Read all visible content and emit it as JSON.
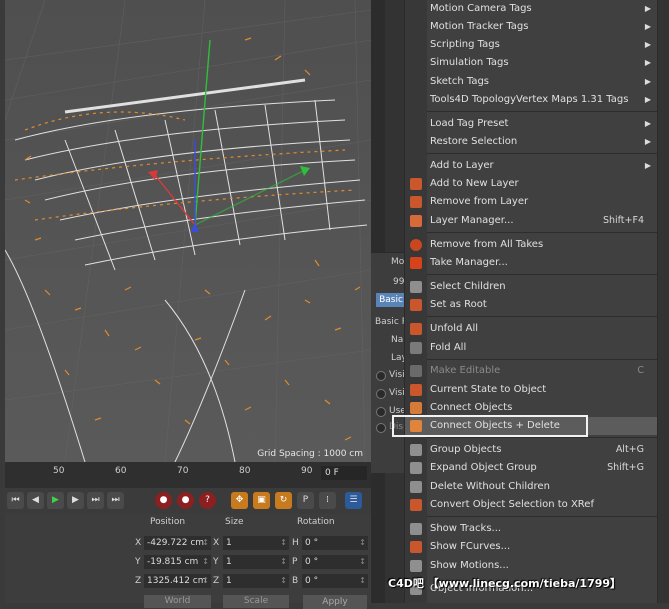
{
  "viewport": {
    "grid_spacing": "Grid Spacing : 1000 cm"
  },
  "attributes": {
    "title_fragment": "Mo",
    "id_fragment": "99",
    "basic_tab": "Basic",
    "basic_header": "Basic P",
    "name_fragment": "Nar",
    "layer_fragment": "Lay",
    "visible1_fragment": "Visi",
    "visible2_fragment": "Visi",
    "use_fragment": "Use",
    "disp_fragment": "Disp"
  },
  "timeline": {
    "ticks": [
      "50",
      "60",
      "70",
      "80",
      "90"
    ],
    "frame": "0 F"
  },
  "coords": {
    "headers": {
      "position": "Position",
      "size": "Size",
      "rotation": "Rotation"
    },
    "rows": [
      {
        "axis": "X",
        "position": "-429.722 cm",
        "size_axis": "X",
        "size": "1",
        "rot_axis": "H",
        "rotation": "0 °"
      },
      {
        "axis": "Y",
        "position": "-19.815 cm",
        "size_axis": "Y",
        "size": "1",
        "rot_axis": "P",
        "rotation": "0 °"
      },
      {
        "axis": "Z",
        "position": "1325.412 cm",
        "size_axis": "Z",
        "size": "1",
        "rot_axis": "B",
        "rotation": "0 °"
      }
    ],
    "world": "World",
    "scale": "Scale",
    "apply": "Apply"
  },
  "menu": {
    "items": [
      {
        "label": "Motion Camera Tags",
        "submenu": true
      },
      {
        "label": "Motion Tracker Tags",
        "submenu": true
      },
      {
        "label": "Scripting Tags",
        "submenu": true
      },
      {
        "label": "Simulation Tags",
        "submenu": true
      },
      {
        "label": "Sketch Tags",
        "submenu": true
      },
      {
        "label": "Tools4D TopologyVertex Maps 1.31 Tags",
        "submenu": true
      },
      {
        "label": "Load Tag Preset",
        "submenu": true
      },
      {
        "label": "Restore Selection",
        "submenu": true
      },
      {
        "label": "Add to Layer",
        "submenu": true
      },
      {
        "label": "Add to New Layer"
      },
      {
        "label": "Remove from Layer"
      },
      {
        "label": "Layer Manager...",
        "shortcut": "Shift+F4"
      },
      {
        "label": "Remove from All Takes"
      },
      {
        "label": "Take Manager..."
      },
      {
        "label": "Select Children"
      },
      {
        "label": "Set as Root"
      },
      {
        "label": "Unfold All"
      },
      {
        "label": "Fold All"
      },
      {
        "label": "Make Editable",
        "shortcut": "C",
        "disabled": true
      },
      {
        "label": "Current State to Object"
      },
      {
        "label": "Connect Objects"
      },
      {
        "label": "Connect Objects + Delete"
      },
      {
        "label": "Group Objects",
        "shortcut": "Alt+G"
      },
      {
        "label": "Expand Object Group",
        "shortcut": "Shift+G"
      },
      {
        "label": "Delete Without Children"
      },
      {
        "label": "Convert Object Selection to XRef"
      },
      {
        "label": "Show Tracks..."
      },
      {
        "label": "Show FCurves..."
      },
      {
        "label": "Show Motions..."
      },
      {
        "label": "Object Information..."
      }
    ]
  },
  "watermark": "C4D吧 【www.linecg.com/tieba/1799】",
  "colors": {
    "highlight_border": "#f2f2f2",
    "accent_orange": "#e08a2e",
    "tab_blue": "#5a84b8"
  }
}
